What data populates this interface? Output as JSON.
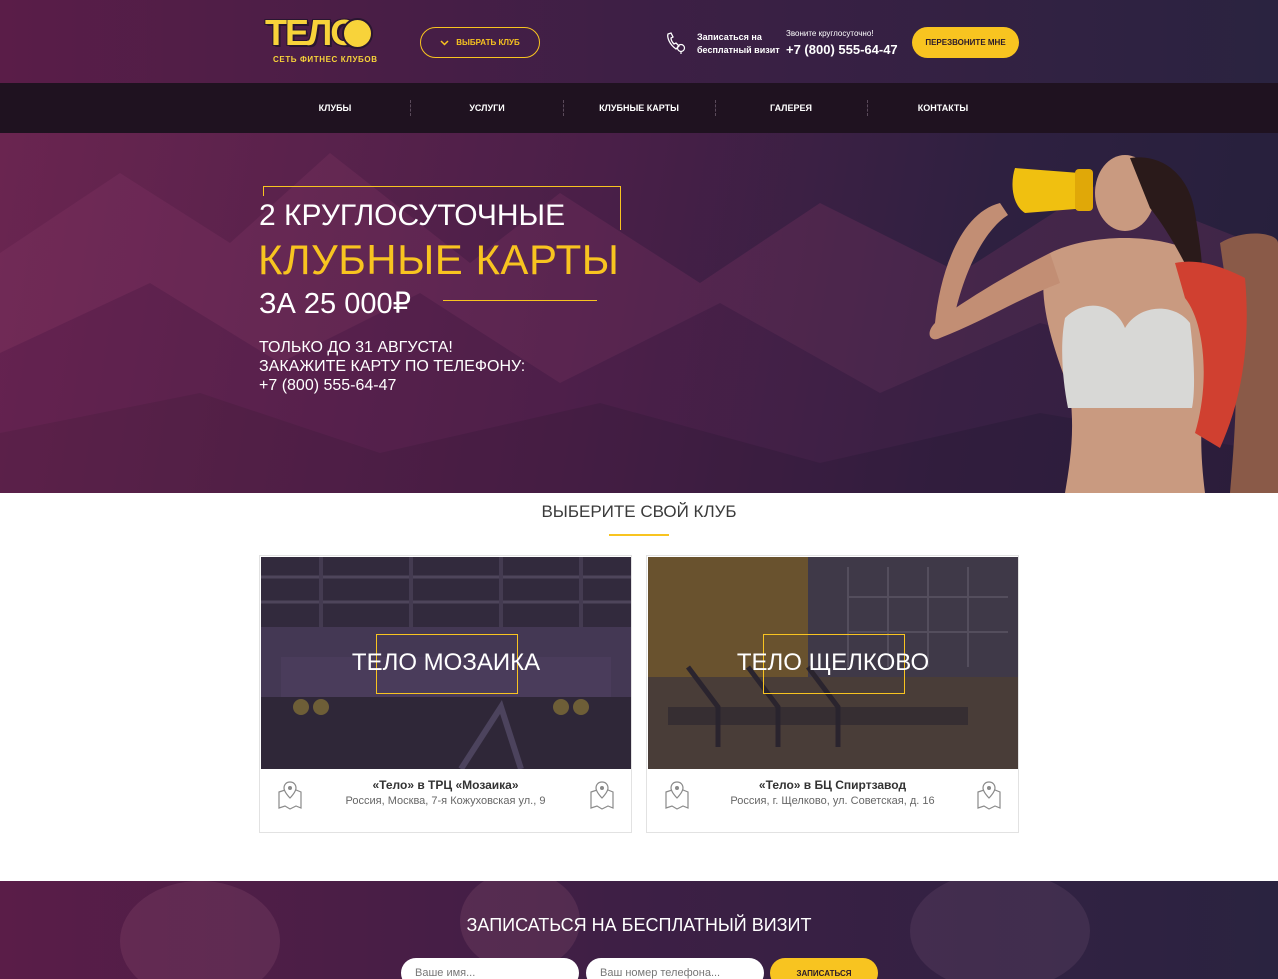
{
  "brand": {
    "logo_text": "ТЕЛО",
    "tagline": "СЕТЬ ФИТНЕС КЛУБОВ"
  },
  "header": {
    "choose_club_label": "ВЫБРАТЬ КЛУБ",
    "visit_label": "Записаться на бесплатный визит",
    "call_note": "Звоните круглосуточно!",
    "phone": "+7 (800) 555-64-47",
    "callback_label": "ПЕРЕЗВОНИТЕ МНЕ"
  },
  "nav": {
    "items": [
      {
        "label": "КЛУБЫ"
      },
      {
        "label": "УСЛУГИ"
      },
      {
        "label": "КЛУБНЫЕ КАРТЫ"
      },
      {
        "label": "ГАЛЕРЕЯ"
      },
      {
        "label": "КОНТАКТЫ"
      }
    ]
  },
  "hero": {
    "line1": "2 КРУГЛОСУТОЧНЫЕ",
    "line2": "КЛУБНЫЕ КАРТЫ",
    "line3": "ЗА 25 000₽",
    "promo_line1": "ТОЛЬКО ДО 31 АВГУСТА!",
    "promo_line2": "ЗАКАЖИТЕ КАРТУ ПО ТЕЛЕФОНУ:",
    "promo_phone": "+7 (800) 555-64-47"
  },
  "clubs": {
    "title": "ВЫБЕРИТЕ СВОЙ КЛУБ",
    "items": [
      {
        "name": "ТЕЛО МОЗАИКА",
        "location": "«Тело» в ТРЦ «Мозаика»",
        "address": "Россия, Москва, 7-я Кожуховская ул., 9"
      },
      {
        "name": "ТЕЛО ЩЕЛКОВО",
        "location": "«Тело» в БЦ Спиртзавод",
        "address": "Россия, г. Щелково, ул. Советская, д. 16"
      }
    ]
  },
  "visit_form": {
    "title": "ЗАПИСАТЬСЯ НА БЕСПЛАТНЫЙ ВИЗИТ",
    "name_placeholder": "Ваше имя...",
    "phone_placeholder": "Ваш номер телефона...",
    "submit_label": "ЗАПИСАТЬСЯ"
  },
  "colors": {
    "accent": "#f8c420",
    "header_bg": "#3d1f45",
    "nav_bg": "#1f1220"
  }
}
